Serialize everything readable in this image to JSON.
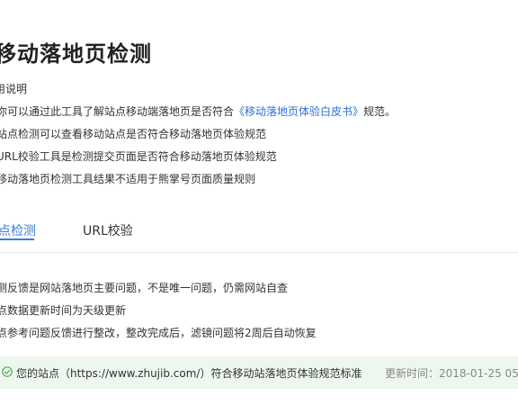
{
  "page": {
    "title": "移动落地页检测"
  },
  "intro": {
    "heading": "用说明",
    "line1_pre": "你可以通过此工具了解站点移动端落地页是否符合",
    "line1_link": "《移动落地页体验白皮书》",
    "line1_post": "规范。",
    "line2": "站点检测可以查看移动站点是否符合移动落地页体验规范",
    "line3": "URL校验工具是检测提交页面是否符合移动落地页体验规范",
    "line4": "移动落地页检测工具结果不适用于熊掌号页面质量规则"
  },
  "tabs": [
    {
      "label": "点检测",
      "active": true
    },
    {
      "label": "URL校验",
      "active": false
    }
  ],
  "tips": [
    "测反馈是网站落地页主要问题，不是唯一问题，仍需网站自查",
    "点数据更新时间为天级更新",
    "点参考问题反馈进行整改，整改完成后，滤镜问题将2周后自动恢复"
  ],
  "result": {
    "status_icon": "check-circle-icon",
    "message": "您的站点（https://www.zhujib.com/）符合移动站落地页体验规范标准",
    "updated": "更新时间：2018-01-25 05:",
    "accent_color": "#4caf50"
  },
  "colors": {
    "link": "#2f6fd6",
    "tab_active": "#3a7be0",
    "result_bg": "#eef7ee"
  }
}
